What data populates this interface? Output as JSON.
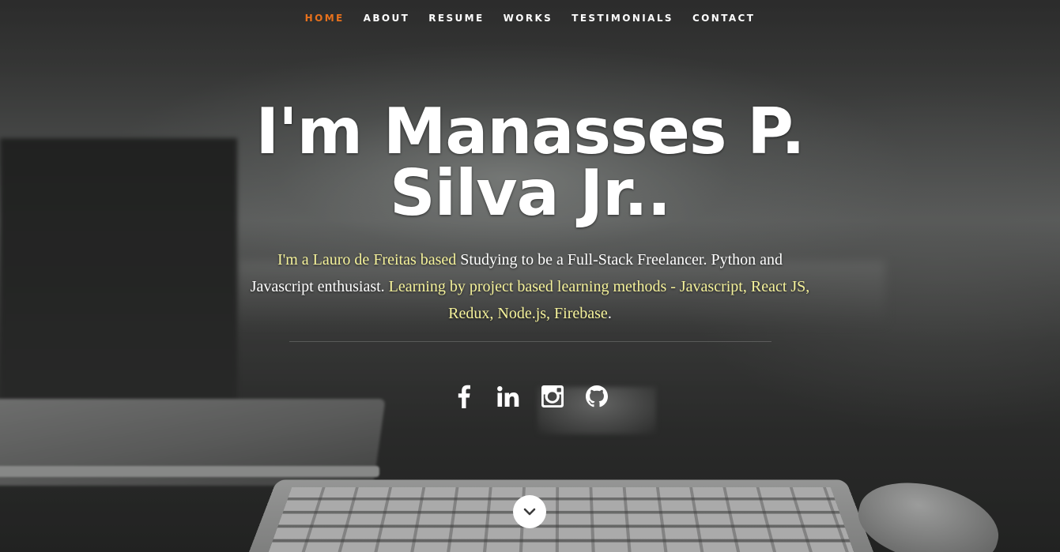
{
  "nav": {
    "items": [
      {
        "label": "HOME",
        "active": true
      },
      {
        "label": "ABOUT",
        "active": false
      },
      {
        "label": "RESUME",
        "active": false
      },
      {
        "label": "WORKS",
        "active": false
      },
      {
        "label": "TESTIMONIALS",
        "active": false
      },
      {
        "label": "CONTACT",
        "active": false
      }
    ],
    "active_color": "#e8711c"
  },
  "banner": {
    "headline": "I'm Manasses P. Silva Jr..",
    "intro": {
      "part1": "I'm a Lauro de Freitas based",
      "part2": " Studying to be a Full-Stack Freelancer. Python and Javascript enthusiast.",
      "part3": " Learning by project based learning methods - Javascript, React JS, Redux, Node.js, Firebase",
      "part4": "."
    },
    "highlight_color": "#f5f29b"
  },
  "social": [
    {
      "icon": "facebook-icon"
    },
    {
      "icon": "linkedin-icon"
    },
    {
      "icon": "instagram-icon"
    },
    {
      "icon": "github-icon"
    }
  ],
  "scroll_icon": "chevron-down-icon"
}
